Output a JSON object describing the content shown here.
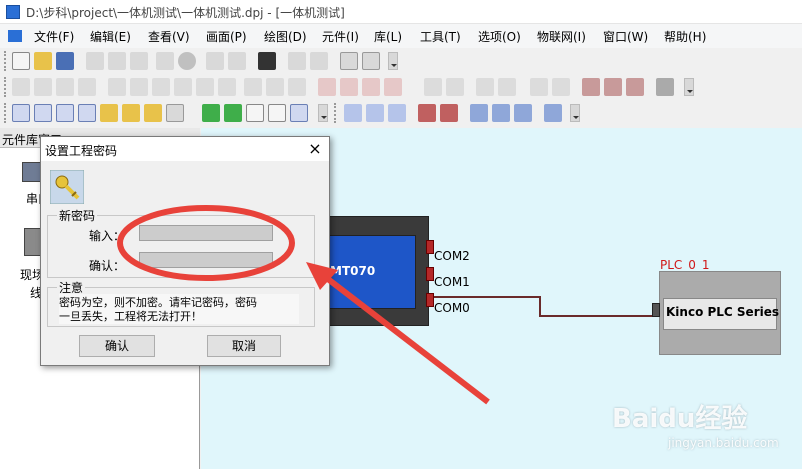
{
  "window": {
    "title": "D:\\步科\\project\\一体机测试\\一体机测试.dpj - [一体机测试]"
  },
  "menu": [
    "文件(F)",
    "编辑(E)",
    "查看(V)",
    "画面(P)",
    "绘图(D)",
    "元件(I)",
    "库(L)",
    "工具(T)",
    "选项(O)",
    "物联网(I)",
    "窗口(W)",
    "帮助(H)"
  ],
  "left_panel": {
    "header": "元件库窗口",
    "items": [
      "串口",
      "现场",
      "线"
    ]
  },
  "canvas": {
    "hmi_label": "MT070",
    "ports": [
      "COM2",
      "COM1",
      "COM0"
    ],
    "plc_id": "PLC_0_1",
    "plc_name": "Kinco PLC Series"
  },
  "dialog": {
    "title": "设置工程密码",
    "close": "×",
    "group_new": "新密码",
    "input_label": "输入：",
    "confirm_label": "确认：",
    "input_value": "",
    "confirm_value": "",
    "note_title": "注意",
    "note_text_1": "密码为空，则不加密。请牢记密码，密码",
    "note_text_2": "一旦丢失，工程将无法打开！",
    "ok": "确认",
    "cancel": "取消"
  },
  "watermark": {
    "logo": "Baidu经验",
    "url": "jingyan.baidu.com"
  },
  "colors": {
    "annotation": "#e8423a",
    "canvas": "#e0f6fb",
    "port": "#b42828"
  }
}
